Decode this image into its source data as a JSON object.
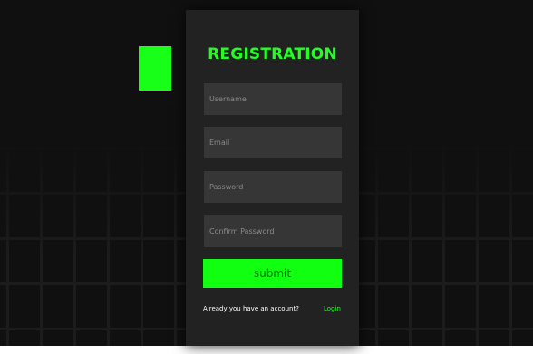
{
  "form": {
    "title": "REGISTRATION",
    "username_placeholder": "Username",
    "email_placeholder": "Email",
    "password_placeholder": "Password",
    "confirm_placeholder": "Confirm Password",
    "submit_label": "submit",
    "account_text": "Already you have an account?",
    "login_label": "Login"
  },
  "colors": {
    "accent": "#11ff11",
    "card": "#222222",
    "input": "#363636",
    "background": "#101010",
    "grid_line": "#12b81b"
  }
}
